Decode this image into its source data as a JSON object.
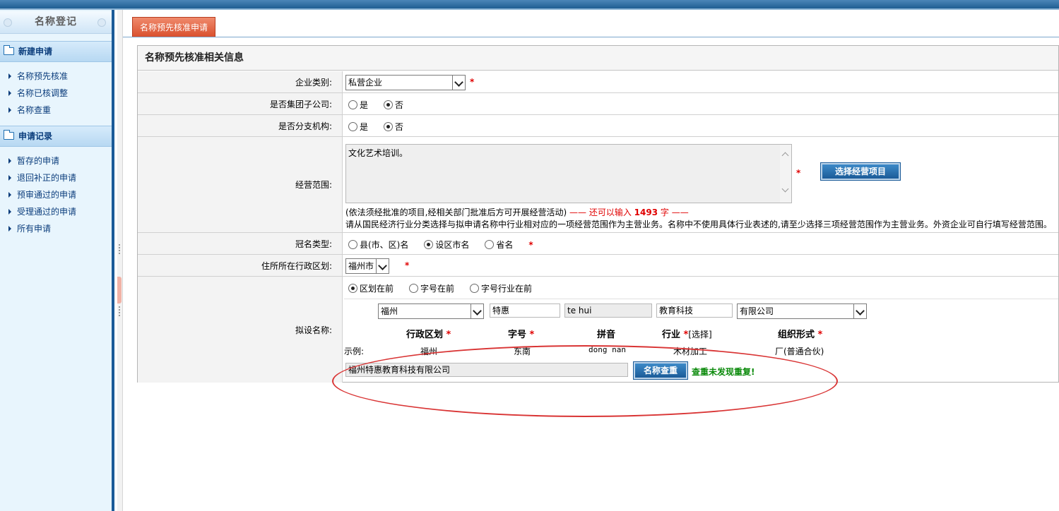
{
  "sidebar": {
    "title": "名称登记",
    "sections": [
      {
        "label": "新建申请",
        "items": [
          "名称预先核准",
          "名称已核调整",
          "名称查重"
        ]
      },
      {
        "label": "申请记录",
        "items": [
          "暂存的申请",
          "退回补正的申请",
          "预审通过的申请",
          "受理通过的申请",
          "所有申请"
        ]
      }
    ]
  },
  "tab": {
    "label": "名称预先核准申请"
  },
  "panel": {
    "title": "名称预先核准相关信息",
    "enterprise_type": {
      "label": "企业类别:",
      "value": "私营企业"
    },
    "group_sub": {
      "label": "是否集团子公司:",
      "yes": "是",
      "no": "否",
      "selected": "no"
    },
    "branch": {
      "label": "是否分支机构:",
      "yes": "是",
      "no": "否",
      "selected": "no"
    },
    "scope": {
      "label": "经营范围:",
      "value": "文化艺术培训。",
      "button": "选择经营项目",
      "note1_prefix": "(依法须经批准的项目,经相关部门批准后方可开展经营活动)",
      "note1_suffix": "—— 还可以输入",
      "count": "1493",
      "note1_unit": "字 ——",
      "note2": "请从国民经济行业分类选择与拟申请名称中行业相对应的一项经营范围作为主营业务。名称中不使用具体行业表述的,请至少选择三项经营范围作为主营业务。外资企业可自行填写经营范围。"
    },
    "crown_type": {
      "label": "冠名类型:",
      "opt1": "县(市、区)名",
      "opt2": "设区市名",
      "opt3": "省名",
      "selected": "opt2"
    },
    "region": {
      "label": "住所所在行政区划:",
      "value": "福州市"
    },
    "proposed": {
      "label": "拟设名称:",
      "order1": "区划在前",
      "order2": "字号在前",
      "order3": "字号行业在前",
      "selected": "order1",
      "district": "福州",
      "trade_name": "特惠",
      "pinyin": "te hui",
      "industry": "教育科技",
      "org_form": "有限公司",
      "headers": {
        "district": "行政区划",
        "trade_name": "字号",
        "pinyin": "拼音",
        "industry": "行业",
        "select": "[选择]",
        "org_form": "组织形式"
      },
      "example": {
        "label": "示例:",
        "district": "福州",
        "trade_name": "东南",
        "pinyin": "dong nan",
        "industry": "木材加工",
        "org_form": "厂(普通合伙)"
      },
      "full_name": "福州特惠教育科技有限公司",
      "check_button": "名称查重",
      "check_result": "查重未发现重复!"
    },
    "required_mark": "*"
  }
}
